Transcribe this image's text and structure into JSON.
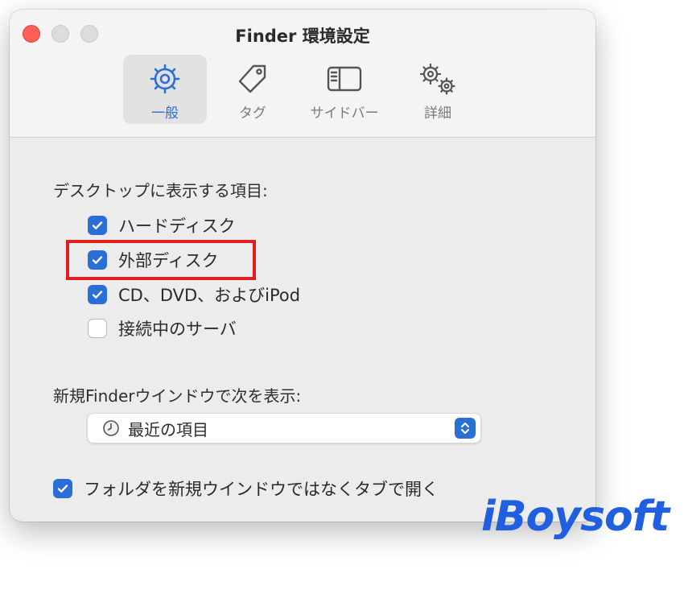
{
  "window": {
    "title": "Finder 環境設定"
  },
  "tabs": [
    {
      "label": "一般",
      "icon": "gear-icon",
      "active": true
    },
    {
      "label": "タグ",
      "icon": "tag-icon",
      "active": false
    },
    {
      "label": "サイドバー",
      "icon": "sidebar-icon",
      "active": false
    },
    {
      "label": "詳細",
      "icon": "gears-icon",
      "active": false
    }
  ],
  "desktop_section": {
    "heading": "デスクトップに表示する項目:",
    "options": [
      {
        "label": "ハードディスク",
        "checked": true
      },
      {
        "label": "外部ディスク",
        "checked": true
      },
      {
        "label": "CD、DVD、およびiPod",
        "checked": true
      },
      {
        "label": "接続中のサーバ",
        "checked": false
      }
    ]
  },
  "new_window_section": {
    "heading": "新規Finderウインドウで次を表示:",
    "selected": "最近の項目"
  },
  "tab_option": {
    "label": "フォルダを新規ウインドウではなくタブで開く",
    "checked": true
  },
  "watermark": "iBoysoft",
  "colors": {
    "accent": "#2a6ed8",
    "highlight_box": "#e01f1f",
    "close": "#fe5f57"
  }
}
